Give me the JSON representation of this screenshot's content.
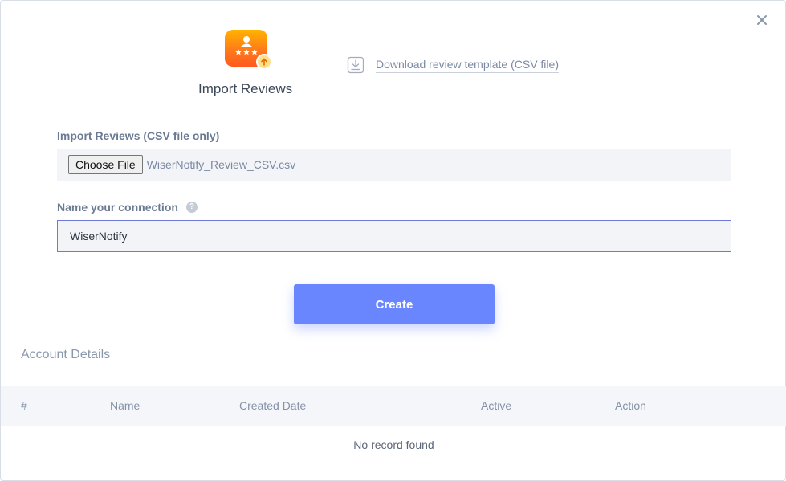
{
  "header": {
    "title": "Import Reviews",
    "template_link": "Download review template (CSV file)",
    "icons": {
      "app": "review-import-icon",
      "download": "download-icon",
      "close": "close-icon"
    }
  },
  "form": {
    "csv_label": "Import Reviews (CSV file only)",
    "choose_file_label": "Choose File",
    "file_name": "WiserNotify_Review_CSV.csv",
    "name_label": "Name your connection",
    "name_value": "WiserNotify",
    "create_label": "Create"
  },
  "account": {
    "title": "Account Details",
    "columns": [
      "#",
      "Name",
      "Created Date",
      "Active",
      "Action"
    ],
    "empty_text": "No record found"
  },
  "colors": {
    "accent": "#6a86ff",
    "input_border": "#6f7ad8",
    "icon_orange": "#ff7a1a"
  }
}
